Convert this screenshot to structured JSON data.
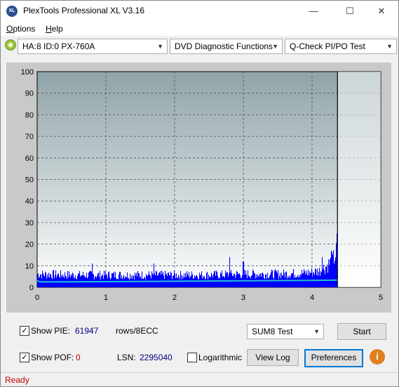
{
  "window": {
    "title": "PlexTools Professional XL V3.16",
    "icon_text": "XL"
  },
  "window_buttons": {
    "minimize": "—",
    "maximize": "☐",
    "close": "✕"
  },
  "menu": {
    "options": {
      "first": "O",
      "rest": "ptions"
    },
    "help": {
      "first": "H",
      "rest": "elp"
    }
  },
  "toolbar": {
    "drive_select": "HA:8 ID:0  PX-760A",
    "function_select": "DVD Diagnostic Functions",
    "test_select": "Q-Check PI/PO Test"
  },
  "chart_data": {
    "type": "bar",
    "xlim": [
      0,
      5
    ],
    "ylim": [
      0,
      100
    ],
    "xticks": [
      "0",
      "1",
      "2",
      "3",
      "4",
      "5"
    ],
    "yticks": [
      "0",
      "10",
      "20",
      "30",
      "40",
      "50",
      "60",
      "70",
      "80",
      "90",
      "100"
    ],
    "grid": true,
    "end_marker_x": 4.37,
    "pie_profile": {
      "x": [
        0,
        0.5,
        1.0,
        1.5,
        2.0,
        2.5,
        3.0,
        3.5,
        3.9,
        4.1,
        4.2,
        4.3,
        4.35
      ],
      "y": [
        7,
        6.5,
        6.5,
        6.5,
        6.5,
        6.5,
        7,
        7,
        7.5,
        8.5,
        11,
        14,
        18
      ]
    },
    "pie_peaks": {
      "x": [
        0.8,
        1.7,
        2.8,
        3.0,
        4.15,
        4.28,
        4.36
      ],
      "y": [
        11,
        11,
        14,
        12,
        14,
        17,
        25
      ]
    },
    "pof_line": {
      "x": [
        0,
        0.05,
        0.2,
        1.0,
        2.0,
        3.0,
        4.0,
        4.37
      ],
      "y": [
        3,
        2.5,
        2.5,
        2.6,
        2.8,
        3.0,
        3.2,
        3.3
      ]
    },
    "colors": {
      "bars": "#0000ff",
      "line": "#20c0d0",
      "plot_bg_top": "#8fa3a8",
      "plot_bg_bottom": "#ffffff"
    }
  },
  "controls": {
    "show_pie_label": "Show PIE:",
    "pie_value": "61947",
    "pie_unit": "rows/8ECC",
    "show_pof_label": "Show POF:",
    "pof_value": "0",
    "lsn_label": "LSN:",
    "lsn_value": "2295040",
    "logarithmic_label": "Logarithmic",
    "test_select": "SUM8 Test",
    "start_button": "Start",
    "view_log_button": "View Log",
    "preferences_button": "Preferences",
    "info_button": "i",
    "show_pie_checked": "✓",
    "show_pof_checked": "✓",
    "colors": {
      "pie_value": "#000080",
      "pof_value": "#c00000"
    }
  },
  "status": {
    "text": "Ready"
  }
}
